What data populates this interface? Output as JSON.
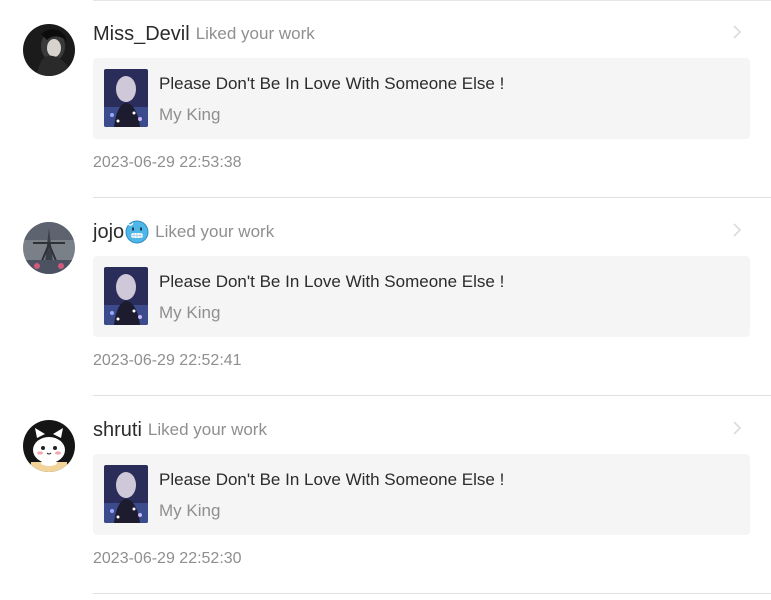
{
  "notifications": [
    {
      "username": "Miss_Devil",
      "action": "Liked your work",
      "work_title": "Please Don't Be In Love With Someone Else !",
      "work_author": "My King",
      "timestamp": "2023-06-29 22:53:38",
      "avatar_icon": "dark-portrait-avatar",
      "badge_icon": ""
    },
    {
      "username": "jojo",
      "action": "Liked your work",
      "work_title": "Please Don't Be In Love With Someone Else !",
      "work_author": "My King",
      "timestamp": "2023-06-29 22:52:41",
      "avatar_icon": "eiffel-tower-avatar",
      "badge_icon": "cold-face-emoji"
    },
    {
      "username": "shruti",
      "action": "Liked your work",
      "work_title": "Please Don't Be In Love With Someone Else !",
      "work_author": "My King",
      "timestamp": "2023-06-29 22:52:30",
      "avatar_icon": "cartoon-cat-avatar",
      "badge_icon": ""
    }
  ],
  "colors": {
    "card_background": "#f5f5f5",
    "secondary_text": "#8f8f8f",
    "primary_text": "#2b2b2b",
    "divider": "#e0e0e0"
  }
}
